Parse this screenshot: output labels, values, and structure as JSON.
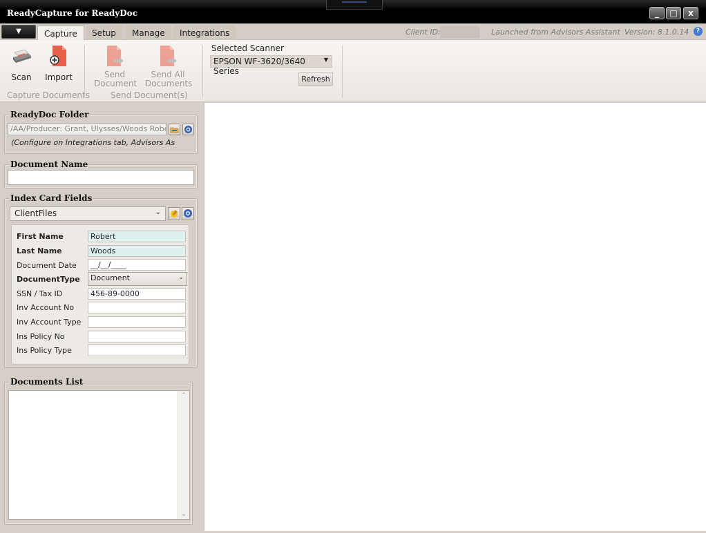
{
  "window": {
    "title": "ReadyCapture for ReadyDoc",
    "controls": {
      "minimize": "_",
      "maximize": "□",
      "close": "x"
    }
  },
  "tabs": {
    "items": [
      "Capture",
      "Setup",
      "Manage",
      "Integrations"
    ],
    "active": "Capture",
    "client_id_label": "Client ID:",
    "launched_from": "Launched from Advisors Assistant",
    "version": "Version: 8.1.0.14"
  },
  "ribbon": {
    "capture_group": {
      "label": "Capture Documents",
      "scan": "Scan",
      "import": "Import"
    },
    "send_group": {
      "label": "Send Document(s)",
      "send_line1": "Send",
      "send_line2": "Document",
      "send_all_line1": "Send All",
      "send_all_line2": "Documents"
    },
    "scanner": {
      "label": "Selected Scanner",
      "value": "EPSON WF-3620/3640 Series",
      "refresh": "Refresh"
    }
  },
  "readydoc_folder": {
    "heading": "ReadyDoc Folder",
    "path": "/AA/Producer: Grant, Ulysses/Woods Robert",
    "note": "(Configure on Integrations tab, Advisors As"
  },
  "document_name": {
    "heading": "Document Name",
    "value": ""
  },
  "index_card": {
    "heading": "Index Card Fields",
    "template": "ClientFiles",
    "fields": [
      {
        "label": "First Name",
        "value": "Robert",
        "bold": true,
        "highlight": true
      },
      {
        "label": "Last Name",
        "value": "Woods",
        "bold": true,
        "highlight": true
      },
      {
        "label": "Document Date",
        "value": "__/__/____",
        "bold": false
      },
      {
        "label": "DocumentType",
        "value": "Document",
        "bold": true,
        "select": true
      },
      {
        "label": "SSN / Tax ID",
        "value": "456-89-0000",
        "bold": false
      },
      {
        "label": "Inv Account No",
        "value": "",
        "bold": false
      },
      {
        "label": "Inv Account Type",
        "value": "",
        "bold": false
      },
      {
        "label": "Ins Policy No",
        "value": "",
        "bold": false
      },
      {
        "label": "Ins Policy Type",
        "value": "",
        "bold": false
      }
    ]
  },
  "documents_list": {
    "heading": "Documents List",
    "items": []
  },
  "colors": {
    "accent": "#3d7bd6",
    "doc_icon": "#e8604c",
    "highlight_field": "#dff1ef"
  }
}
